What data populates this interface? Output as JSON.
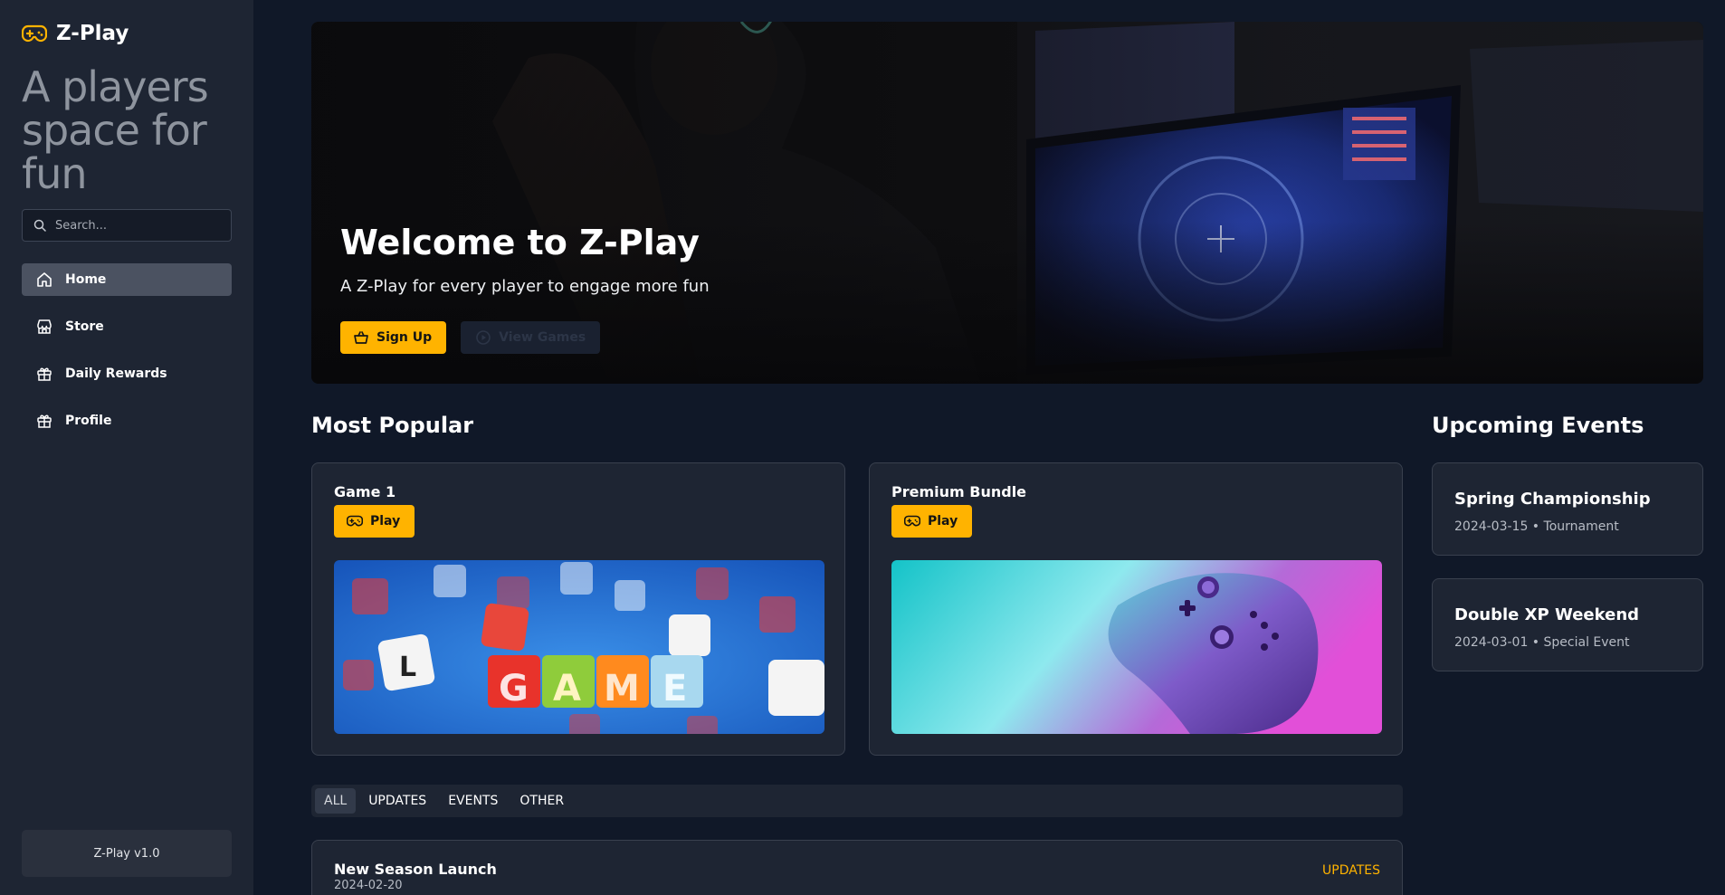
{
  "brand": {
    "name": "Z-Play",
    "tagline": "A players space for fun",
    "accent": "#ffb300",
    "logo_icon": "gamepad-icon"
  },
  "search": {
    "placeholder": "Search..."
  },
  "nav": [
    {
      "label": "Home",
      "icon": "home-icon",
      "active": true
    },
    {
      "label": "Store",
      "icon": "store-icon",
      "active": false
    },
    {
      "label": "Daily Rewards",
      "icon": "gift-icon",
      "active": false
    },
    {
      "label": "Profile",
      "icon": "gift-icon",
      "active": false
    }
  ],
  "version": "Z-Play v1.0",
  "hero": {
    "title": "Welcome to Z-Play",
    "subtitle": "A Z-Play for every player to engage more fun",
    "primary_label": "Sign Up",
    "secondary_label": "View Games"
  },
  "popular": {
    "heading": "Most Popular",
    "cards": [
      {
        "title": "Game 1",
        "button": "Play",
        "image": "game letter cubes photo"
      },
      {
        "title": "Premium Bundle",
        "button": "Play",
        "image": "purple game controller photo"
      }
    ]
  },
  "events": {
    "heading": "Upcoming Events",
    "items": [
      {
        "title": "Spring Championship",
        "meta": "2024-03-15 • Tournament"
      },
      {
        "title": "Double XP Weekend",
        "meta": "2024-03-01 • Special Event"
      }
    ]
  },
  "tabs": [
    {
      "label": "ALL",
      "active": true
    },
    {
      "label": "UPDATES",
      "active": false
    },
    {
      "label": "EVENTS",
      "active": false
    },
    {
      "label": "OTHER",
      "active": false
    }
  ],
  "news": [
    {
      "title": "New Season Launch",
      "date": "2024-02-20",
      "tag": "UPDATES"
    }
  ]
}
